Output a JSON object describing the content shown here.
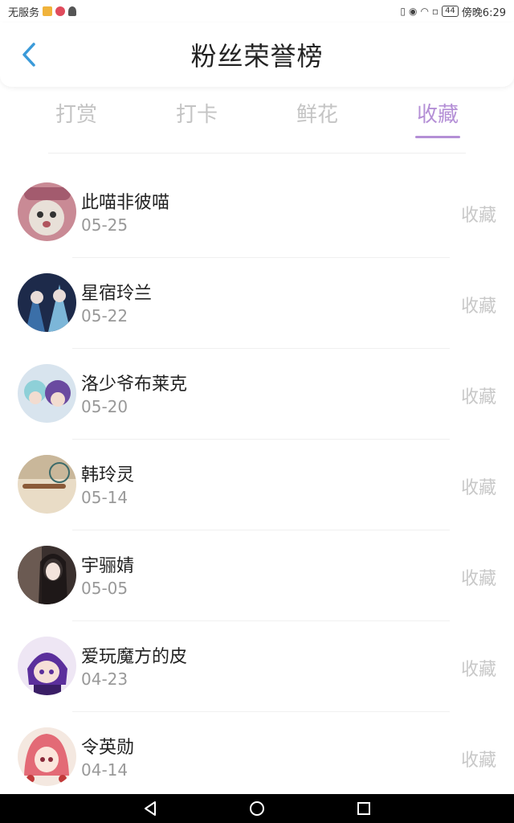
{
  "status_bar": {
    "carrier": "无服务",
    "battery": "44",
    "time": "傍晚6:29"
  },
  "header": {
    "title": "粉丝荣誉榜"
  },
  "tabs": [
    {
      "label": "打赏"
    },
    {
      "label": "打卡"
    },
    {
      "label": "鲜花"
    },
    {
      "label": "收藏"
    }
  ],
  "active_tab": "收藏",
  "colors": {
    "accent": "#b48fd6",
    "back": "#3a9ad9"
  },
  "list": [
    {
      "name": "此喵非彼喵",
      "date": "05-25",
      "action": "收藏"
    },
    {
      "name": "星宿玲兰",
      "date": "05-22",
      "action": "收藏"
    },
    {
      "name": "洛少爷布莱克",
      "date": "05-20",
      "action": "收藏"
    },
    {
      "name": "韩玲灵",
      "date": "05-14",
      "action": "收藏"
    },
    {
      "name": "宇骊婧",
      "date": "05-05",
      "action": "收藏"
    },
    {
      "name": "爱玩魔方的皮",
      "date": "04-23",
      "action": "收藏"
    },
    {
      "name": "令英勋",
      "date": "04-14",
      "action": "收藏"
    }
  ]
}
